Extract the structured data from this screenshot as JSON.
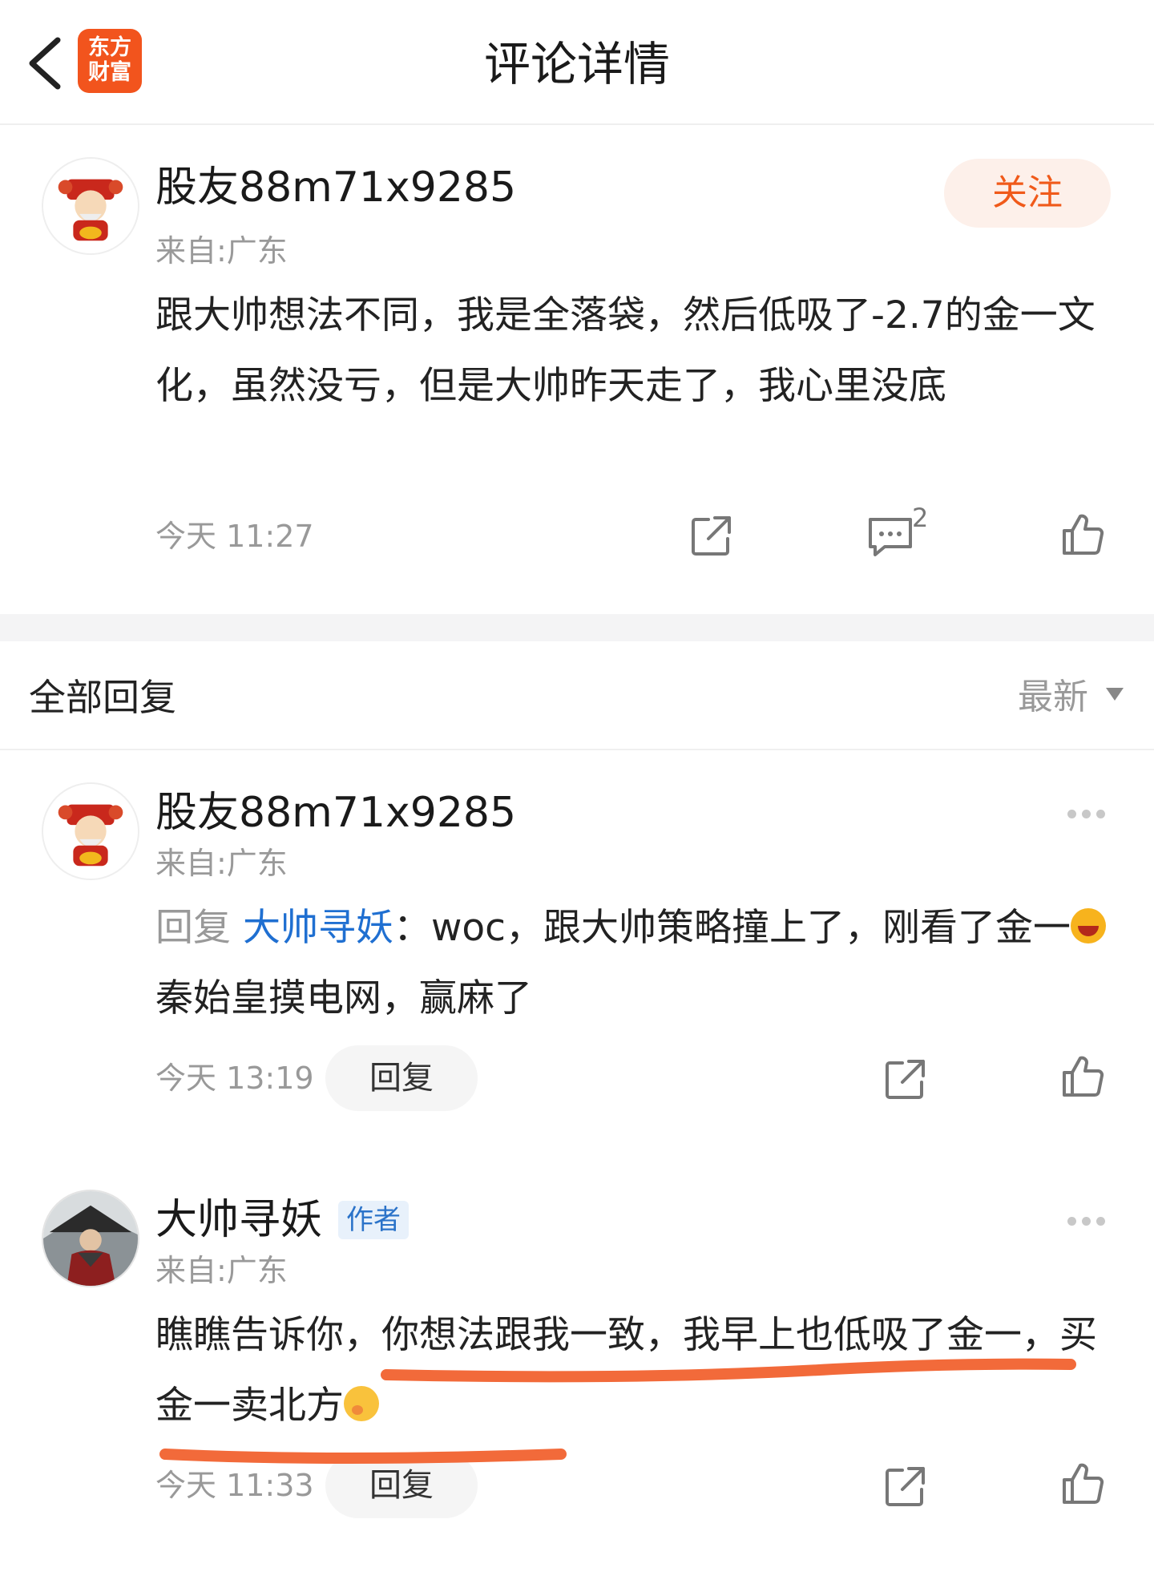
{
  "header": {
    "title": "评论详情",
    "logo_line1": "东方",
    "logo_line2": "财富"
  },
  "post": {
    "username": "股友88m71x9285",
    "location": "来自:广东",
    "follow_label": "关注",
    "content": "跟大帅想法不同，我是全落袋，然后低吸了-2.7的金一文化，虽然没亏，但是大帅昨天走了，我心里没底",
    "time": "今天 11:27",
    "comment_count": "2"
  },
  "replies_section": {
    "title": "全部回复",
    "sort_label": "最新"
  },
  "replies": [
    {
      "username": "股友88m71x9285",
      "location": "来自:广东",
      "reply_prefix": "回复 ",
      "mention": "大帅寻妖",
      "text_part1": "：woc，跟大帅策略撞上了，刚看了金一",
      "text_part2": "秦始皇摸电网，赢麻了",
      "time": "今天 13:19",
      "reply_label": "回复"
    },
    {
      "username": "大帅寻妖",
      "badge": "作者",
      "location": "来自:广东",
      "text": "瞧瞧告诉你，你想法跟我一致，我早上也低吸了金一，买金一卖北方",
      "time": "今天 11:33",
      "reply_label": "回复"
    }
  ],
  "colors": {
    "accent": "#f05a1a",
    "mention": "#1f6fd1",
    "underline": "#f26a3a"
  }
}
